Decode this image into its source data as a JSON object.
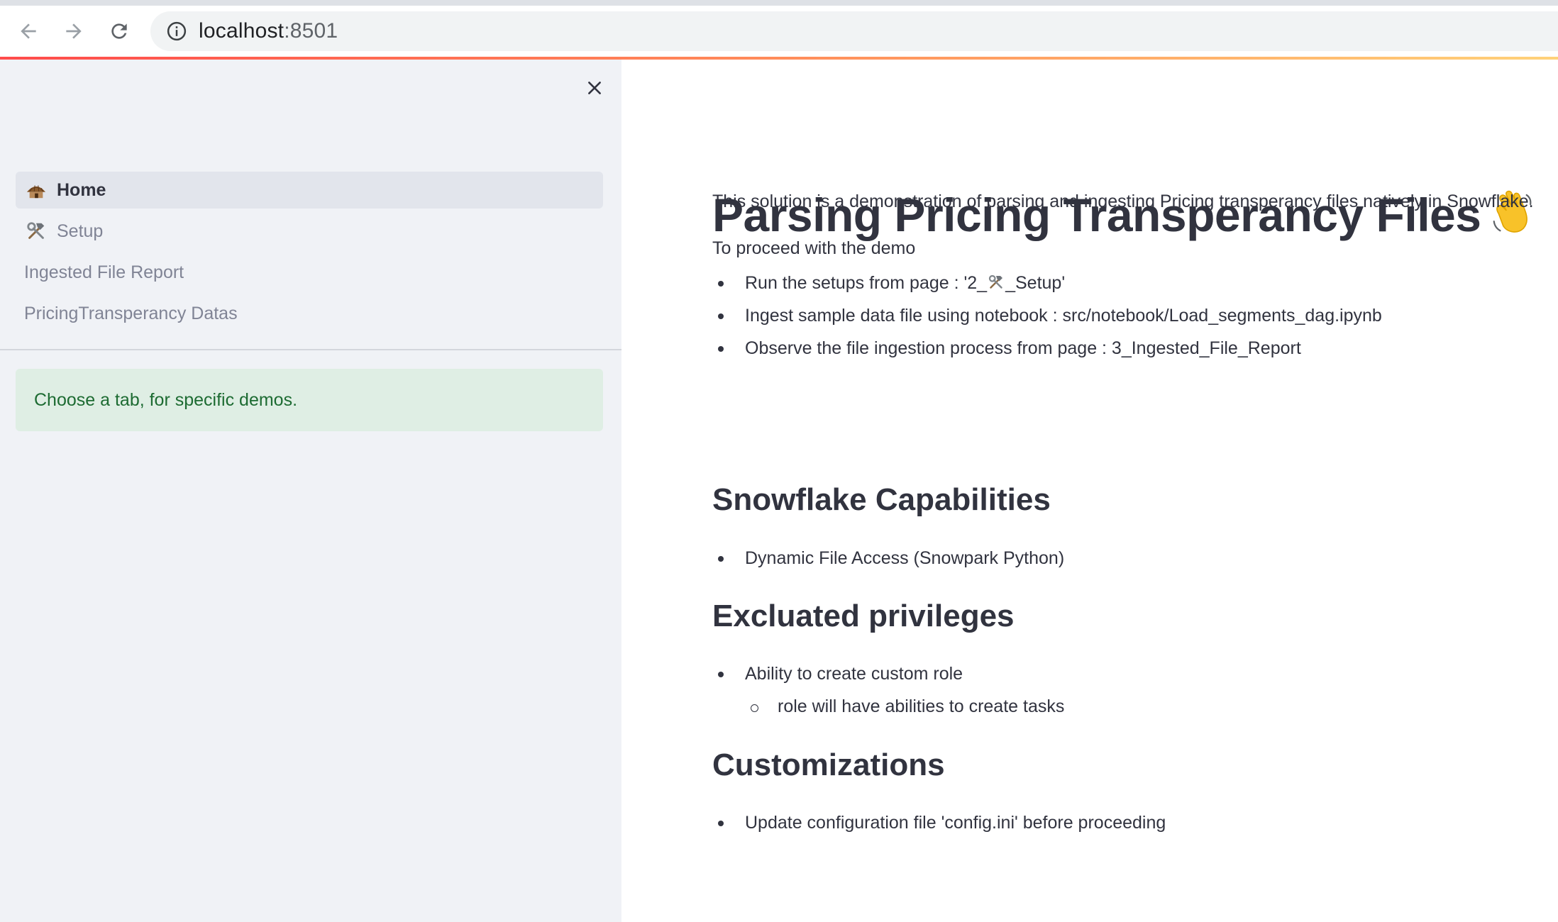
{
  "browser": {
    "url_host": "localhost",
    "url_port": ":8501"
  },
  "sidebar": {
    "nav_items": [
      {
        "label": "Home",
        "icon": "hut-icon",
        "active": true
      },
      {
        "label": "Setup",
        "icon": "hammer-wrench-icon",
        "active": false
      },
      {
        "label": "Ingested File Report",
        "active": false
      },
      {
        "label": "PricingTransperancy Datas",
        "active": false
      }
    ],
    "info_text": "Choose a tab, for specific demos."
  },
  "main": {
    "title": "Parsing Pricing Transperancy Files",
    "title_emoji": "waving-hand-icon",
    "intro": "This solution is a demonstration of parsing and ingesting Pricing transperancy files natively in Snowflake.",
    "proceed": "To proceed with the demo",
    "steps": [
      {
        "before": "Run the setups from page : '2_",
        "icon": "hammer-wrench-icon",
        "after": "_Setup'"
      },
      {
        "text": "Ingest sample data file using notebook : src/notebook/Load_segments_dag.ipynb"
      },
      {
        "text": "Observe the file ingestion process from page : 3_Ingested_File_Report"
      }
    ],
    "capabilities_heading": "Snowflake Capabilities",
    "capabilities": [
      "Dynamic File Access (Snowpark Python)"
    ],
    "privileges_heading": "Excluated privileges",
    "privileges": [
      "Ability to create custom role"
    ],
    "privileges_sub": [
      "role will have abilities to create tasks"
    ],
    "customizations_heading": "Customizations",
    "customizations": [
      "Update configuration file 'config.ini' before proceeding"
    ]
  },
  "colors": {
    "sidebar_bg": "#f0f2f6",
    "active_nav_bg": "#e2e5ec",
    "info_bg": "#dfeee4",
    "info_text": "#1d6b32",
    "text": "#31333f",
    "accent_gradient": [
      "#ff4b4b",
      "#ffd27a"
    ]
  }
}
